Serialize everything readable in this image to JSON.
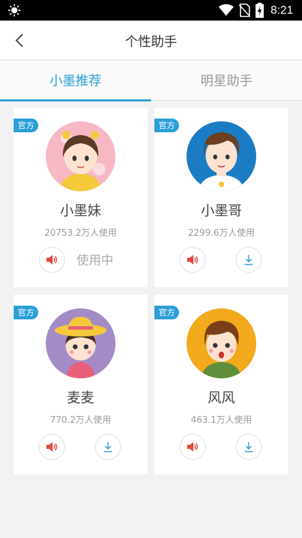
{
  "status_bar": {
    "time": "8:21",
    "icons": [
      "brightness-icon",
      "wifi-icon",
      "no-sim-icon",
      "battery-charging-icon"
    ]
  },
  "header": {
    "title": "个性助手",
    "back_icon": "chevron-left-icon"
  },
  "tabs": [
    {
      "label": "小墨推荐",
      "active": true
    },
    {
      "label": "明星助手",
      "active": false
    }
  ],
  "assistants": [
    {
      "badge": "官方",
      "name": "小墨妹",
      "users": "20753.2万人使用",
      "status": "使用中",
      "in_use": true
    },
    {
      "badge": "官方",
      "name": "小墨哥",
      "users": "2299.6万人使用",
      "in_use": false
    },
    {
      "badge": "官方",
      "name": "麦麦",
      "users": "770.2万人使用",
      "in_use": false
    },
    {
      "badge": "官方",
      "name": "风风",
      "users": "463.1万人使用",
      "in_use": false
    }
  ],
  "colors": {
    "accent": "#2b9fd7",
    "voice": "#e5473f"
  }
}
